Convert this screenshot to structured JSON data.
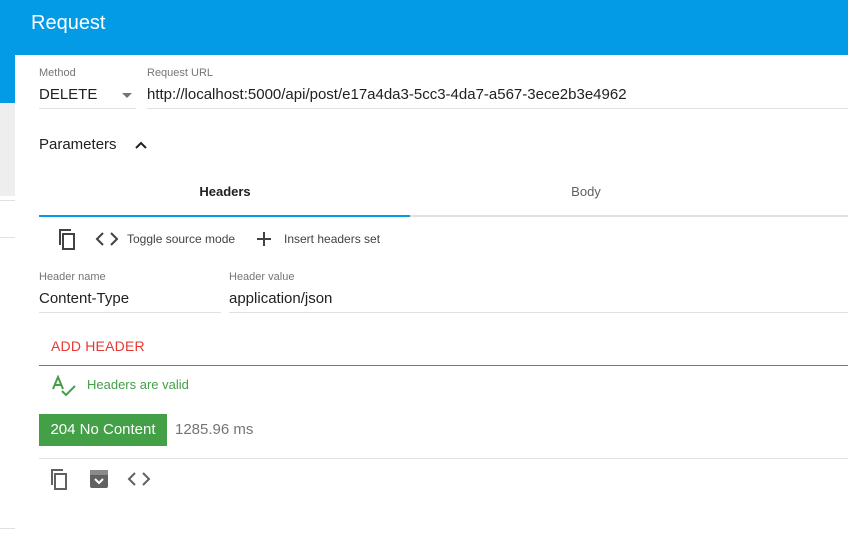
{
  "header": {
    "title": "Request"
  },
  "method": {
    "label": "Method",
    "value": "DELETE"
  },
  "url": {
    "label": "Request URL",
    "value": "http://localhost:5000/api/post/e17a4da3-5cc3-4da7-a567-3ece2b3e4962"
  },
  "parameters": {
    "label": "Parameters",
    "icon": "chevron-up-icon"
  },
  "tabs": [
    {
      "label": "Headers",
      "active": true
    },
    {
      "label": "Body",
      "active": false
    }
  ],
  "header_toolbar": {
    "copy_icon": "copy-icon",
    "toggle_source_label": "Toggle source mode",
    "insert_set_label": "Insert headers set"
  },
  "header_row": {
    "name_label": "Header name",
    "name_value": "Content-Type",
    "value_label": "Header value",
    "value_value": "application/json"
  },
  "add_header_label": "ADD HEADER",
  "validation": {
    "text": "Headers are valid",
    "color": "#43a047"
  },
  "response": {
    "status": "204 No Content",
    "status_color": "#43a047",
    "time": "1285.96 ms"
  },
  "colors": {
    "primary": "#039be5",
    "accent_red": "#e53935"
  }
}
